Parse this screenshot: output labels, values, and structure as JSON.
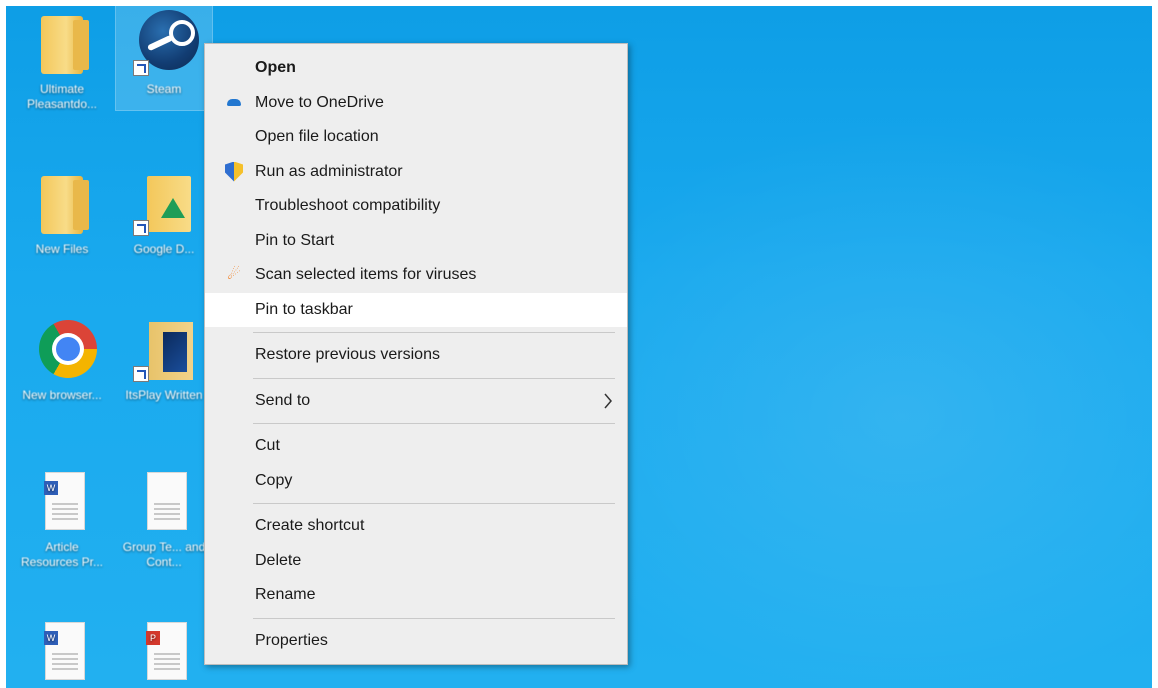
{
  "desktop": {
    "icons": [
      {
        "name": "desktop-icon-folder-1",
        "label": "Ultimate Pleasantdo..."
      },
      {
        "name": "desktop-icon-steam",
        "label": "Steam"
      },
      {
        "name": "desktop-icon-new-files",
        "label": "New Files"
      },
      {
        "name": "desktop-icon-google-drive",
        "label": "Google D..."
      },
      {
        "name": "desktop-icon-chrome",
        "label": "New browser..."
      },
      {
        "name": "desktop-icon-folder-2",
        "label": "ItsPlay Written"
      },
      {
        "name": "desktop-icon-doc-1",
        "label": "Article Resources Pr..."
      },
      {
        "name": "desktop-icon-doc-2",
        "label": "Group Te... and Cont..."
      }
    ]
  },
  "context_menu": {
    "items": {
      "open": "Open",
      "move_to_onedrive": "Move to OneDrive",
      "open_file_location": "Open file location",
      "run_as_administrator": "Run as administrator",
      "troubleshoot_compatibility": "Troubleshoot compatibility",
      "pin_to_start": "Pin to Start",
      "scan_for_viruses": "Scan selected items for viruses",
      "pin_to_taskbar": "Pin to taskbar",
      "restore_previous_versions": "Restore previous versions",
      "send_to": "Send to",
      "cut": "Cut",
      "copy": "Copy",
      "create_shortcut": "Create shortcut",
      "delete": "Delete",
      "rename": "Rename",
      "properties": "Properties"
    },
    "highlighted_item": "Pin to taskbar",
    "icons": {
      "move_to_onedrive": "onedrive-icon",
      "run_as_administrator": "shield-icon",
      "scan_for_viruses": "avast-icon",
      "send_to": "chevron-right-icon"
    }
  },
  "colors": {
    "desktop_background": "#19a9ee",
    "menu_background": "#eeeeee",
    "menu_highlight": "#ffffff"
  }
}
